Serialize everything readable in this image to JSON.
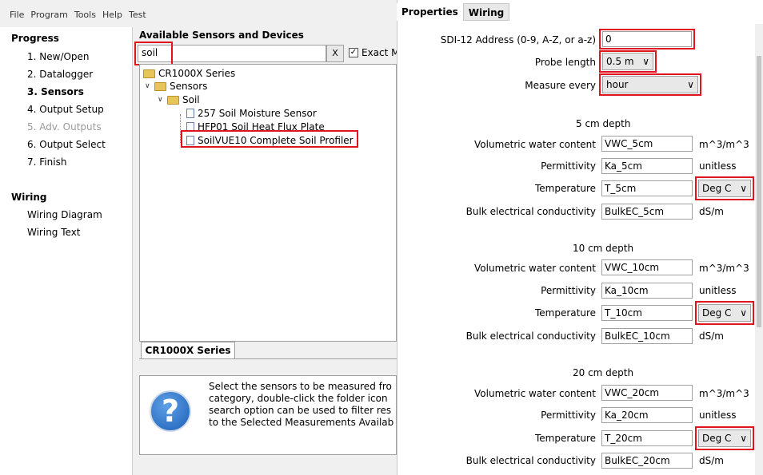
{
  "menu": [
    "File",
    "Program",
    "Tools",
    "Help",
    "Test"
  ],
  "nav": {
    "progress_heading": "Progress",
    "items": [
      "1. New/Open",
      "2. Datalogger",
      "3. Sensors",
      "4. Output Setup",
      "5. Adv. Outputs",
      "6. Output Select",
      "7. Finish"
    ],
    "wiring_heading": "Wiring",
    "wiring_items": [
      "Wiring Diagram",
      "Wiring Text"
    ]
  },
  "sensors": {
    "title": "Available Sensors and Devices",
    "search_value": "soil",
    "clear_label": "X",
    "exact_label": "Exact M",
    "tree": {
      "root": "CR1000X Series",
      "sensors": "Sensors",
      "soil": "Soil",
      "items": [
        "257 Soil Moisture Sensor",
        "HFP01 Soil Heat Flux Plate",
        "SoilVUE10 Complete Soil Profiler"
      ]
    },
    "tab_label": "CR1000X Series",
    "help_text": "Select the sensors to be measured fro\ncategory, double-click the folder icon\nsearch option can be used to filter res\nto the Selected Measurements Availab"
  },
  "properties": {
    "tabs": [
      "Properties",
      "Wiring"
    ],
    "address_label": "SDI-12 Address (0-9, A-Z, or a-z)",
    "address_value": "0",
    "probe_label": "Probe length",
    "probe_value": "0.5 m",
    "measure_label": "Measure every",
    "measure_value": "hour",
    "field_labels": {
      "vwc": "Volumetric water content",
      "perm": "Permittivity",
      "temp": "Temperature",
      "bulk": "Bulk electrical conductivity"
    },
    "units": {
      "vwc": "m^3/m^3",
      "perm": "unitless",
      "bulk": "dS/m",
      "temp": "Deg C"
    },
    "depths": [
      {
        "title": "5 cm depth",
        "vwc": "VWC_5cm",
        "perm": "Ka_5cm",
        "temp": "T_5cm",
        "bulk": "BulkEC_5cm"
      },
      {
        "title": "10 cm depth",
        "vwc": "VWC_10cm",
        "perm": "Ka_10cm",
        "temp": "T_10cm",
        "bulk": "BulkEC_10cm"
      },
      {
        "title": "20 cm depth",
        "vwc": "VWC_20cm",
        "perm": "Ka_20cm",
        "temp": "T_20cm",
        "bulk": "BulkEC_20cm"
      }
    ]
  },
  "colors": {
    "highlight": "#e0141e"
  }
}
